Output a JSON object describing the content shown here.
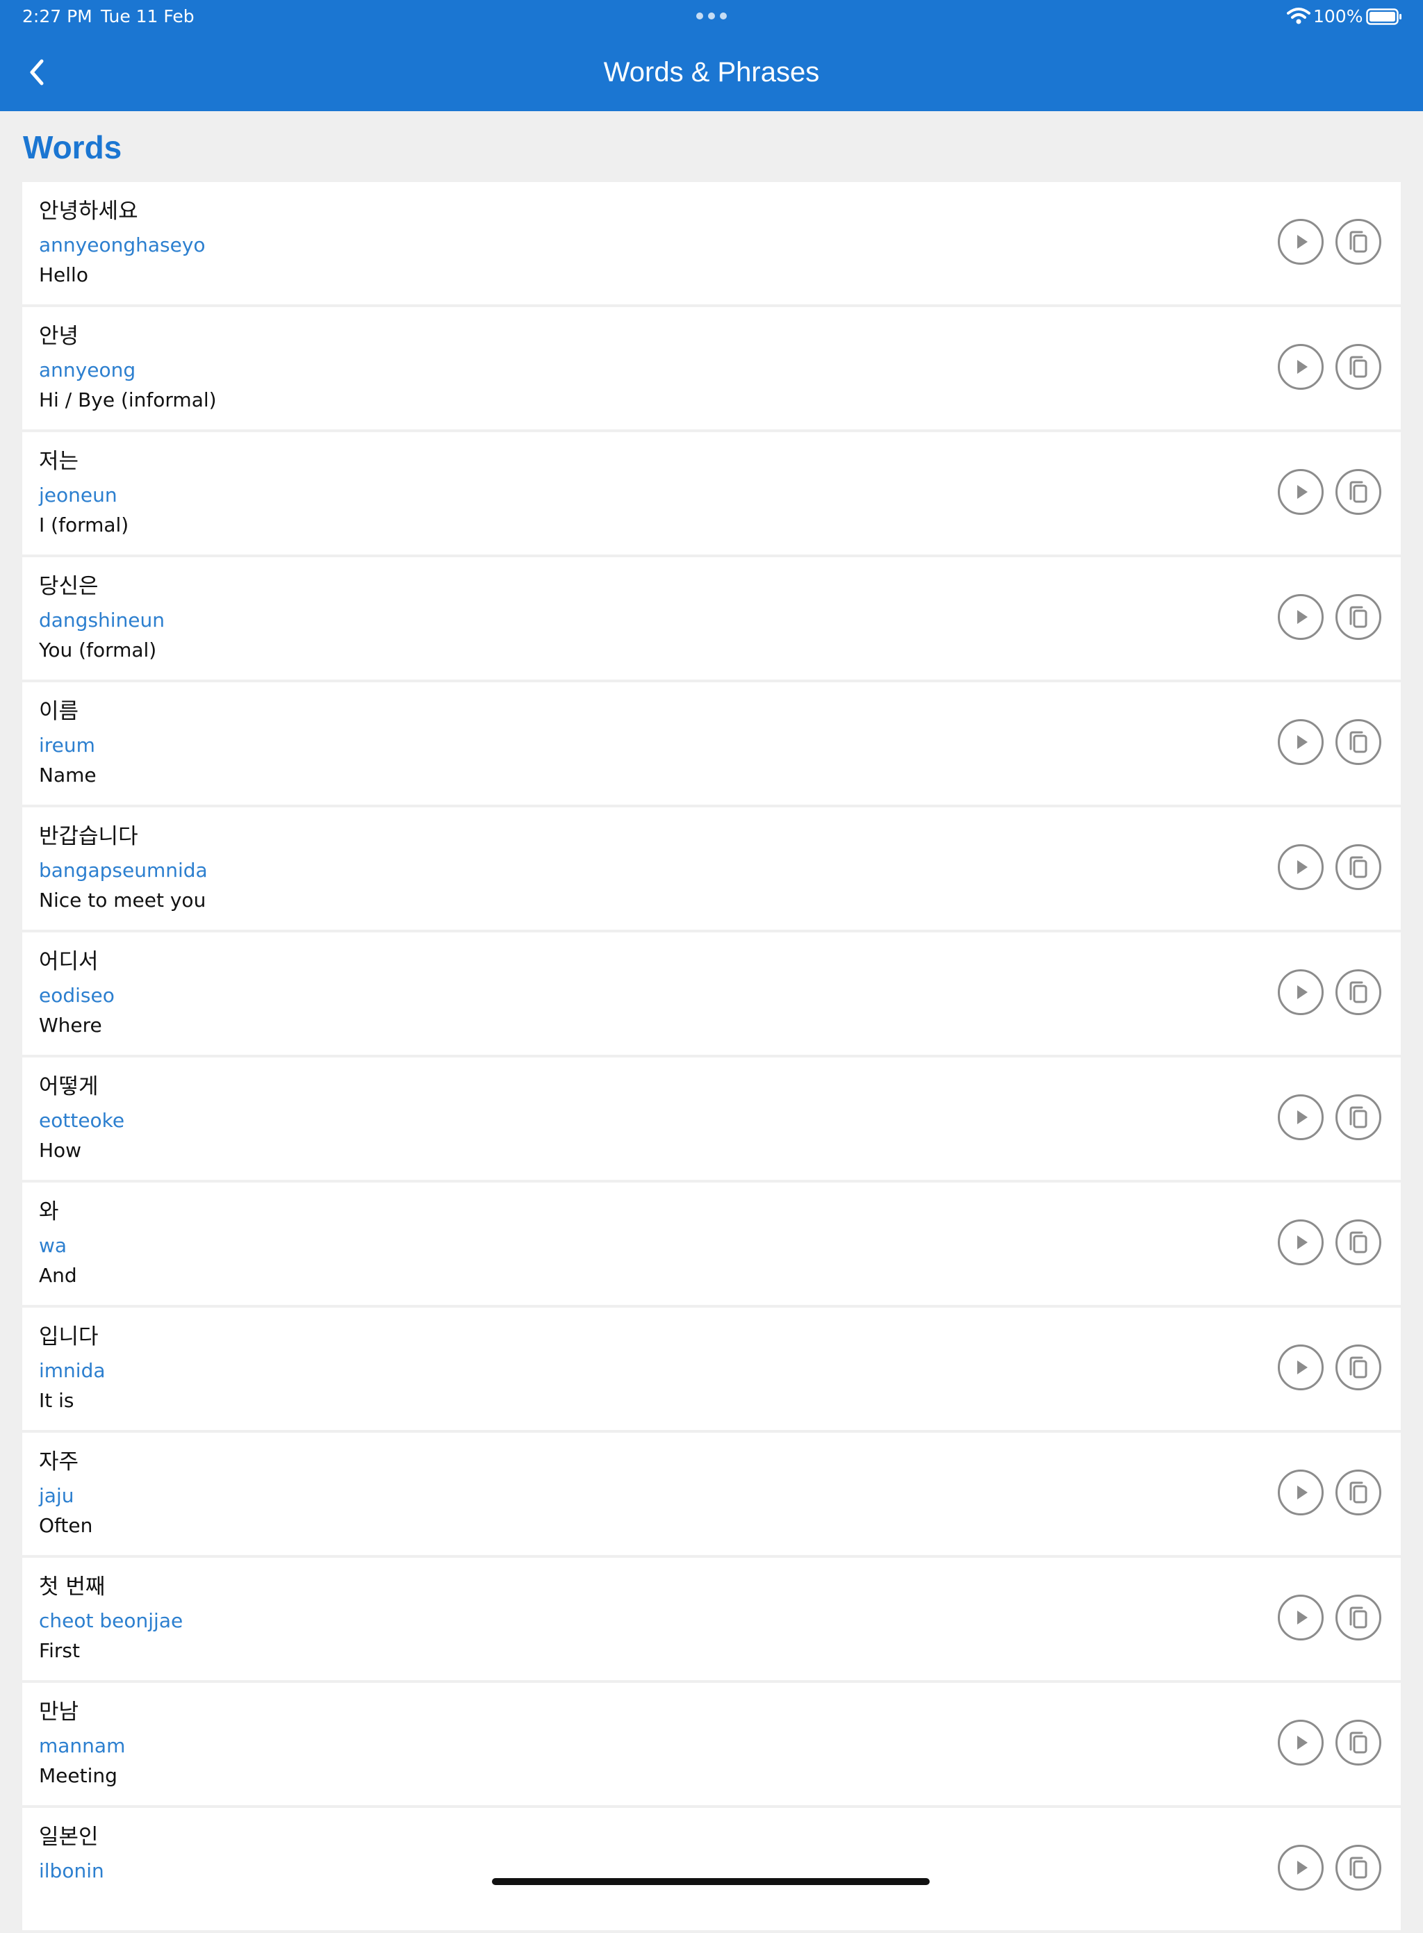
{
  "status_bar": {
    "time": "2:27 PM",
    "date": "Tue 11 Feb",
    "battery": "100%"
  },
  "nav": {
    "back_icon": "chevron-left-icon",
    "title": "Words & Phrases"
  },
  "section": {
    "title": "Words"
  },
  "words": [
    {
      "korean": "안녕하세요",
      "romanization": "annyeonghaseyo",
      "translation": "Hello"
    },
    {
      "korean": "안녕",
      "romanization": "annyeong",
      "translation": "Hi / Bye (informal)"
    },
    {
      "korean": "저는",
      "romanization": "jeoneun",
      "translation": "I (formal)"
    },
    {
      "korean": "당신은",
      "romanization": "dangshineun",
      "translation": "You (formal)"
    },
    {
      "korean": "이름",
      "romanization": "ireum",
      "translation": "Name"
    },
    {
      "korean": "반갑습니다",
      "romanization": "bangapseumnida",
      "translation": "Nice to meet you"
    },
    {
      "korean": "어디서",
      "romanization": "eodiseo",
      "translation": "Where"
    },
    {
      "korean": "어떻게",
      "romanization": "eotteoke",
      "translation": "How"
    },
    {
      "korean": "와",
      "romanization": "wa",
      "translation": "And"
    },
    {
      "korean": "입니다",
      "romanization": "imnida",
      "translation": "It is"
    },
    {
      "korean": "자주",
      "romanization": "jaju",
      "translation": "Often"
    },
    {
      "korean": "첫 번째",
      "romanization": "cheot beonjjae",
      "translation": "First"
    },
    {
      "korean": "만남",
      "romanization": "mannam",
      "translation": "Meeting"
    },
    {
      "korean": "일본인",
      "romanization": "ilbonin",
      "translation": ""
    }
  ],
  "row_icons": {
    "play": "play-icon",
    "copy": "copy-icon"
  },
  "colors": {
    "accent": "#1b76d2",
    "romanization": "#2c7fcf",
    "background": "#efefef",
    "card": "#ffffff",
    "icon_outline": "#8c8c8c"
  }
}
